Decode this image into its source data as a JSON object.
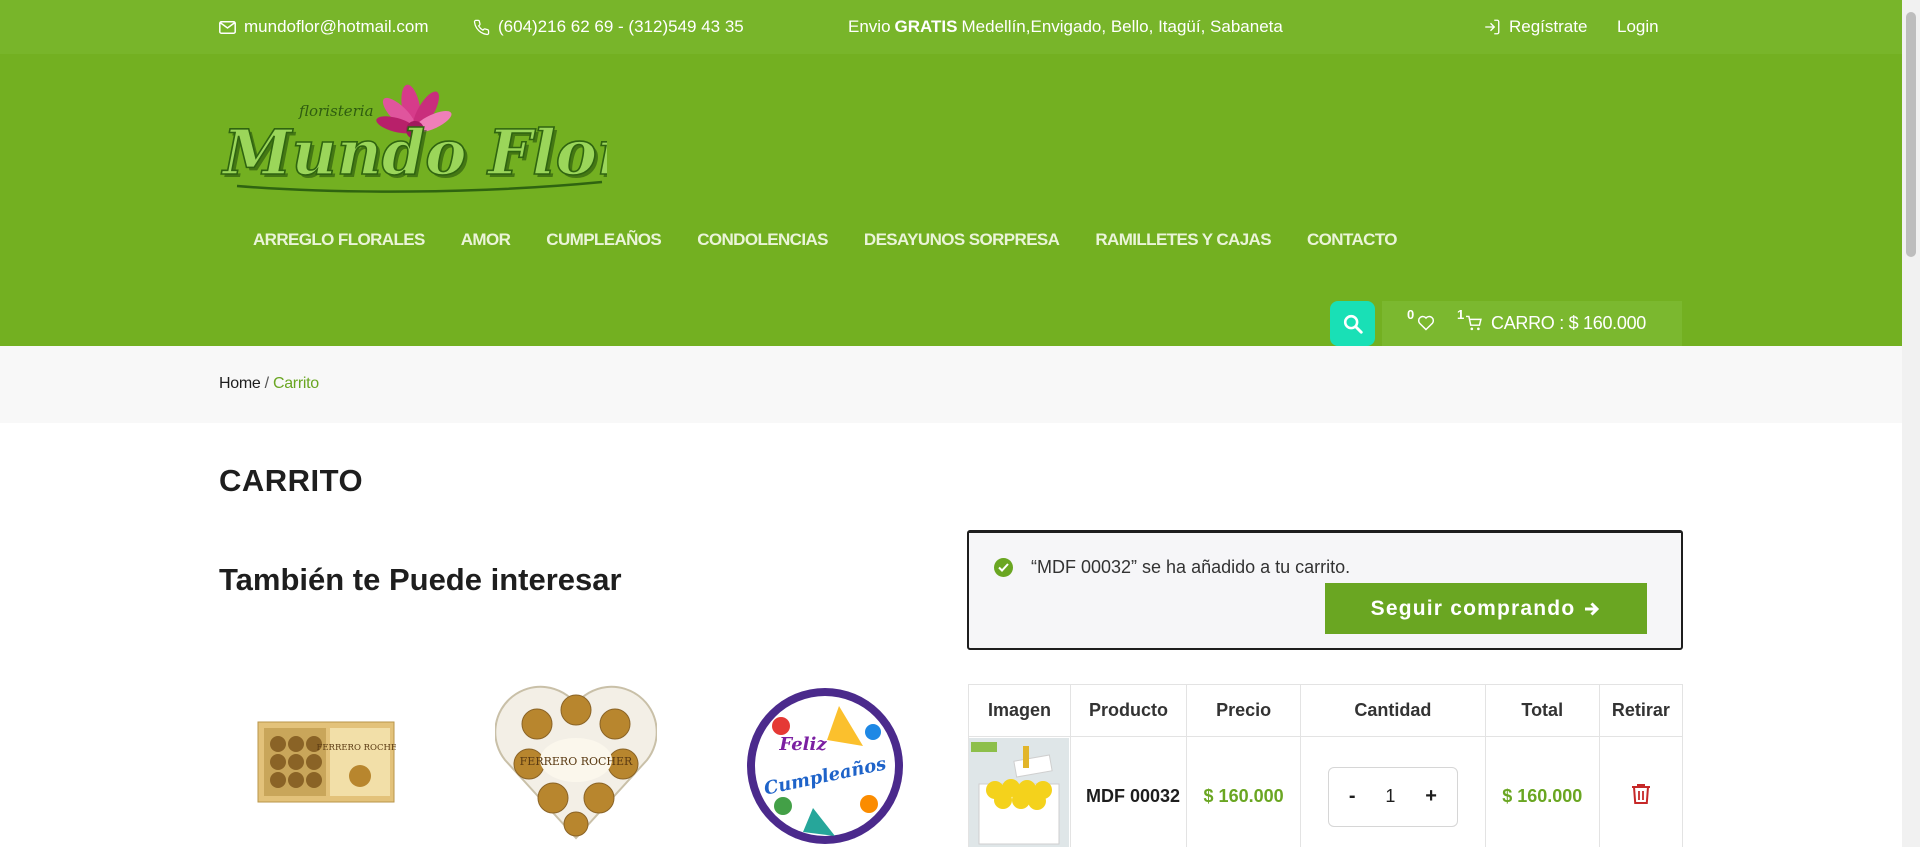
{
  "topbar": {
    "email": "mundoflor@hotmail.com",
    "phone": "(604)216 62 69 - (312)549 43 35",
    "shipping_prefix": "Envio",
    "shipping_bold": "GRATIS",
    "shipping_cities": "Medellín,Envigado, Bello, Itagüí, Sabaneta",
    "register": "Regístrate",
    "login": "Login",
    "icons": [
      "envelope-icon",
      "phone-icon",
      "sign-in-icon"
    ]
  },
  "logo": {
    "small": "floristeria",
    "main": "Mundo Flor"
  },
  "nav": [
    "ARREGLO FLORALES",
    "AMOR",
    "CUMPLEAÑOS",
    "CONDOLENCIAS",
    "DESAYUNOS SORPRESA",
    "RAMILLETES Y CAJAS",
    "CONTACTO"
  ],
  "header_tools": {
    "wishlist_count": "0",
    "cart_count": "1",
    "cart_label": "CARRO : $ 160.000",
    "icons": [
      "search-icon",
      "heart-icon",
      "cart-icon"
    ]
  },
  "breadcrumb": {
    "home": "Home",
    "separator": "/",
    "current": "Carrito"
  },
  "page_title": "CARRITO",
  "related_title": "También te Puede interesar",
  "notice": {
    "message": "“MDF 00032” se ha añadido a tu carrito.",
    "button": "Seguir comprando"
  },
  "cart_table": {
    "headers": [
      "Imagen",
      "Producto",
      "Precio",
      "Cantidad",
      "Total",
      "Retirar"
    ],
    "rows": [
      {
        "product": "MDF 00032",
        "price": "$ 160.000",
        "quantity": "1",
        "minus": "-",
        "plus": "+",
        "total": "$ 160.000"
      }
    ]
  },
  "related_products": {
    "p1_text": "FERRERO ROCHER",
    "p2_text": "FERRERO ROCHER",
    "p3_line1": "Feliz",
    "p3_line2": "Cumpleaños"
  },
  "colors": {
    "topbar": "#78b52a",
    "header": "#73b021",
    "accent": "#6aa622",
    "search": "#19e0b6"
  }
}
